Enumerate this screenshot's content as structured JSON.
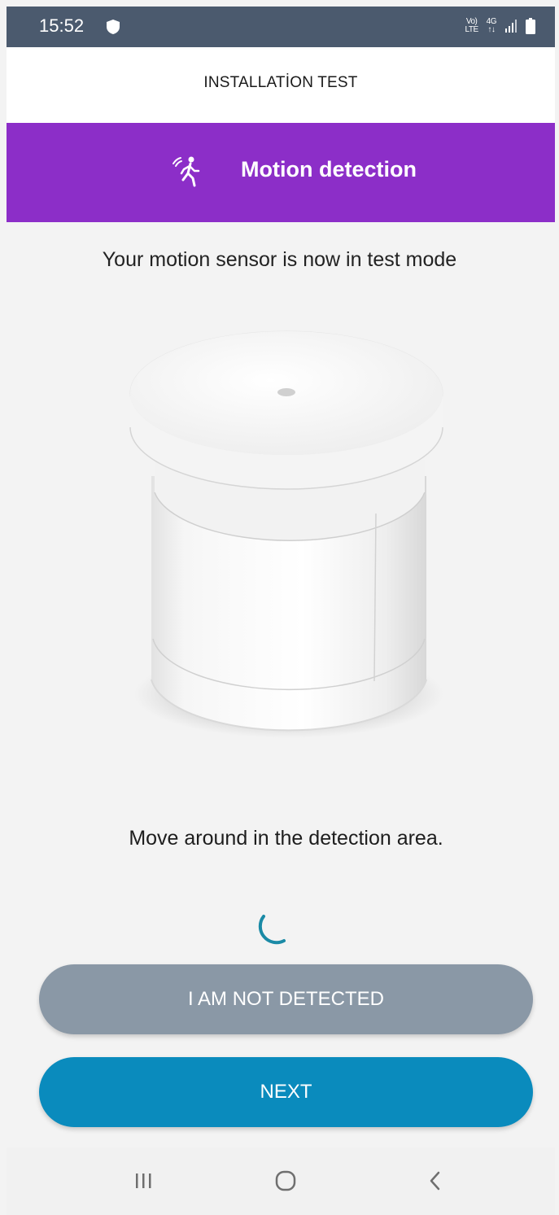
{
  "status_bar": {
    "time": "15:52",
    "net_small_top": "Vo)",
    "net_small_bottom": "LTE",
    "net_4g_top": "4G",
    "net_4g_bottom": "↑↓"
  },
  "top_bar": {
    "title": "INSTALLATİON TEST"
  },
  "banner": {
    "title": "Motion detection",
    "icon": "motion-person-icon",
    "color": "#8c2ec8"
  },
  "main": {
    "test_mode_text": "Your motion sensor is now in test mode",
    "instruction_text": "Move around in the detection area."
  },
  "buttons": {
    "not_detected_label": "I AM NOT DETECTED",
    "next_label": "NEXT"
  },
  "colors": {
    "status_bar": "#4b5a6e",
    "secondary_button": "#8a98a6",
    "primary_button": "#0a8bbd",
    "spinner": "#1a8aa6"
  },
  "nav_bar": {
    "recents": "recents-icon",
    "home": "home-icon",
    "back": "back-icon"
  }
}
